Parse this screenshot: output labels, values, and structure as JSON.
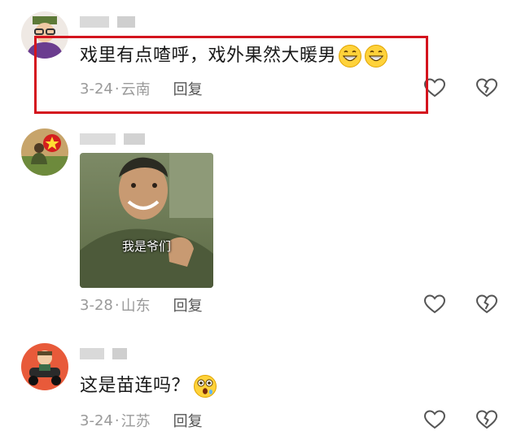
{
  "comments": [
    {
      "text": "戏里有点喳呼，戏外果然大暖男",
      "emoji": [
        "grinning-face-emoji",
        "grinning-face-emoji"
      ],
      "date": "3-24",
      "location": "云南",
      "reply_label": "回复"
    },
    {
      "sticker_caption": "我是爷们",
      "date": "3-28",
      "location": "山东",
      "reply_label": "回复"
    },
    {
      "text": "这是苗连吗？",
      "emoji": [
        "astonished-face-emoji"
      ],
      "date": "3-24",
      "location": "江苏",
      "reply_label": "回复"
    }
  ],
  "colors": {
    "highlight_border": "#d4141e",
    "meta_text": "#9a9a9a",
    "icon_stroke": "#555555"
  },
  "icons": [
    "heart-outline-icon",
    "broken-heart-icon"
  ]
}
